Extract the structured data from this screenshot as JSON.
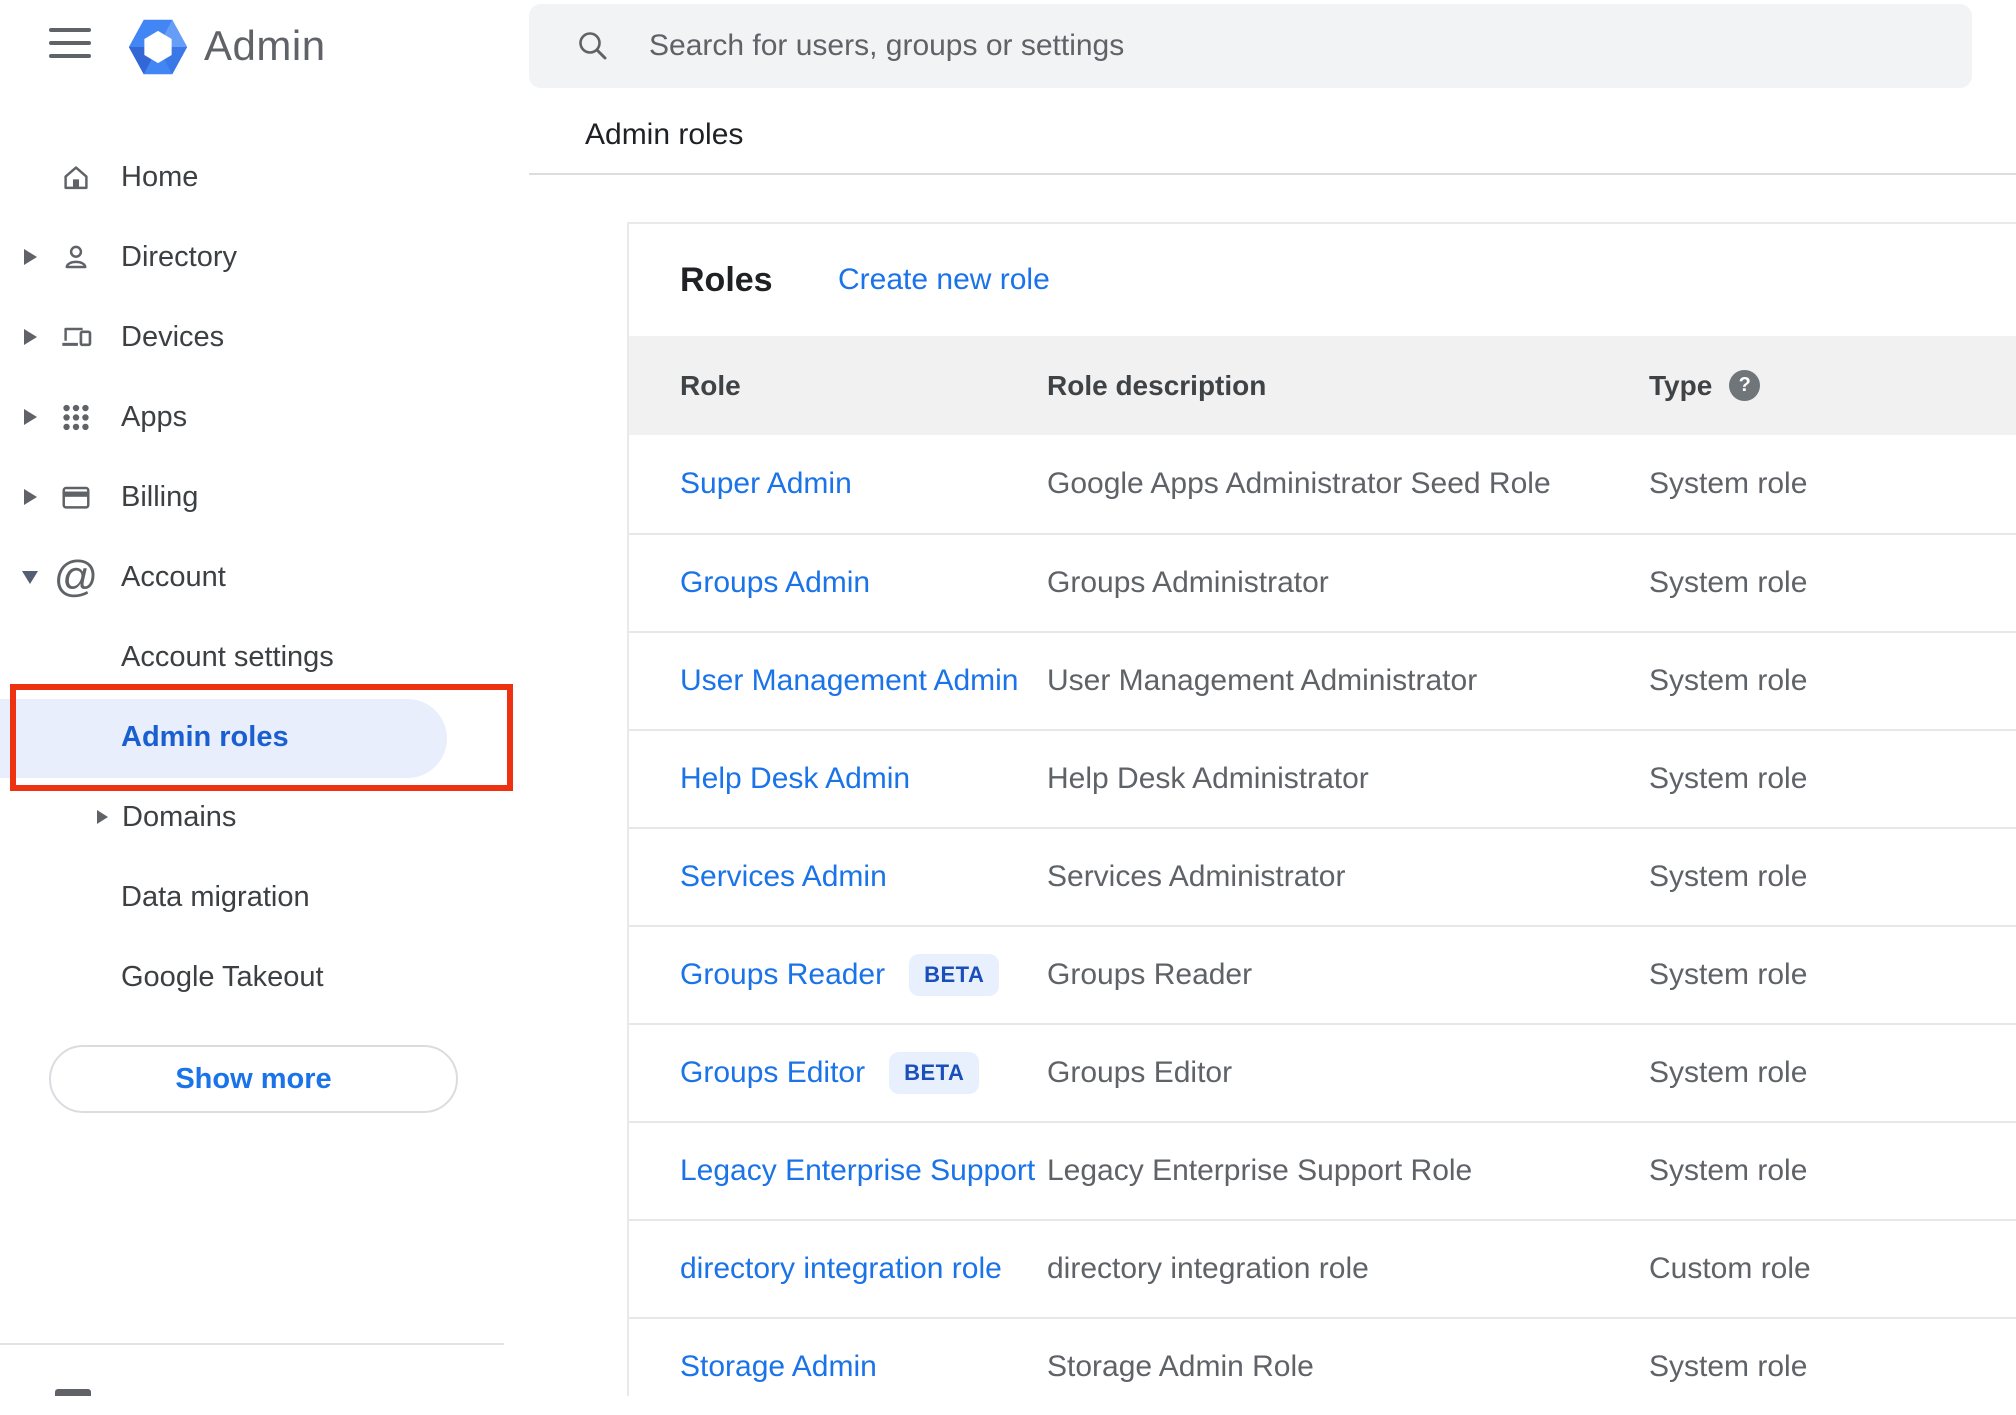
{
  "topbar": {
    "app_name": "Admin"
  },
  "search": {
    "placeholder": "Search for users, groups or settings"
  },
  "breadcrumb": {
    "title": "Admin roles"
  },
  "sidebar": {
    "items": [
      {
        "label": "Home"
      },
      {
        "label": "Directory"
      },
      {
        "label": "Devices"
      },
      {
        "label": "Apps"
      },
      {
        "label": "Billing"
      },
      {
        "label": "Account"
      }
    ],
    "children": [
      {
        "label": "Account settings"
      },
      {
        "label": "Admin roles",
        "active": true
      },
      {
        "label": "Domains"
      },
      {
        "label": "Data migration"
      },
      {
        "label": "Google Takeout"
      }
    ],
    "show_more_label": "Show more"
  },
  "content": {
    "card_title": "Roles",
    "create_link": "Create new role",
    "table": {
      "columns": [
        "Role",
        "Role description",
        "Type"
      ],
      "beta_label": "BETA",
      "rows": [
        {
          "role": "Super Admin",
          "beta": false,
          "description": "Google Apps Administrator Seed Role",
          "type": "System role"
        },
        {
          "role": "Groups Admin",
          "beta": false,
          "description": "Groups Administrator",
          "type": "System role"
        },
        {
          "role": "User Management Admin",
          "beta": false,
          "description": "User Management Administrator",
          "type": "System role"
        },
        {
          "role": "Help Desk Admin",
          "beta": false,
          "description": "Help Desk Administrator",
          "type": "System role"
        },
        {
          "role": "Services Admin",
          "beta": false,
          "description": "Services Administrator",
          "type": "System role"
        },
        {
          "role": "Groups Reader",
          "beta": true,
          "description": "Groups Reader",
          "type": "System role"
        },
        {
          "role": "Groups Editor",
          "beta": true,
          "description": "Groups Editor",
          "type": "System role"
        },
        {
          "role": "Legacy Enterprise Support",
          "beta": false,
          "description": "Legacy Enterprise Support Role",
          "type": "System role"
        },
        {
          "role": "directory integration role",
          "beta": false,
          "description": "directory integration role",
          "type": "Custom role"
        },
        {
          "role": "Storage Admin",
          "beta": false,
          "description": "Storage Admin Role",
          "type": "System role"
        }
      ]
    }
  },
  "colors": {
    "accent_blue": "#1a73e8",
    "active_item_blue": "#1a5fd0",
    "active_pill_bg": "#e8eefb",
    "beta_badge_bg": "#e8f0fe",
    "beta_badge_text": "#1a4fba",
    "annotation_red": "#ee3211",
    "header_band_gray": "#f1f1f1",
    "search_bg": "#f1f3f4",
    "logo_blue": "#4285f4"
  }
}
